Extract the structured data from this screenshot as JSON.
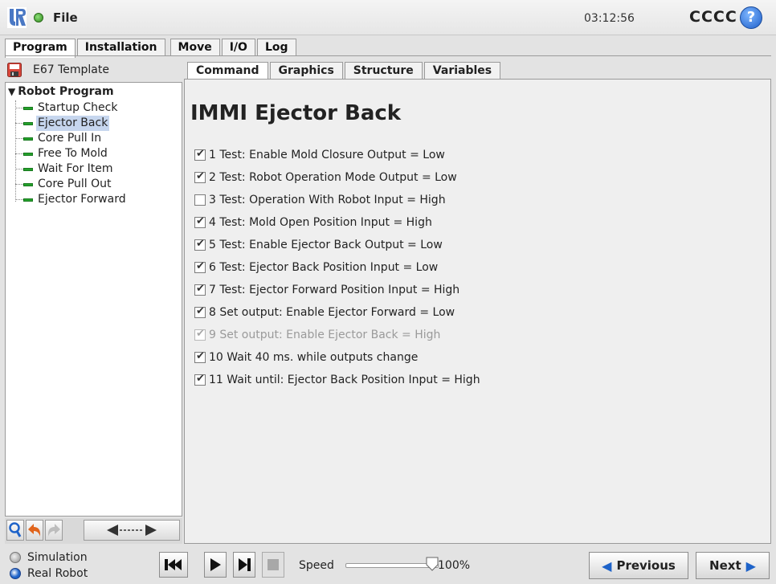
{
  "topbar": {
    "file_label": "File",
    "time": "03:12:56",
    "robot_name": "CCCC",
    "help_glyph": "?"
  },
  "main_tabs": [
    "Program",
    "Installation",
    "Move",
    "I/O",
    "Log"
  ],
  "left": {
    "program_name": "E67 Template",
    "tree_root": "Robot Program",
    "tree_items": [
      "Startup Check",
      "Ejector Back",
      "Core Pull In",
      "Free To Mold",
      "Wait For Item",
      "Core Pull Out",
      "Ejector Forward"
    ],
    "selected_item": "Ejector Back"
  },
  "sub_tabs": [
    "Command",
    "Graphics",
    "Structure",
    "Variables"
  ],
  "content": {
    "title": "IMMI Ejector Back",
    "checks": [
      {
        "label": "1 Test: Enable Mold Closure Output = Low",
        "checked": true,
        "enabled": true
      },
      {
        "label": "2 Test: Robot Operation Mode Output = Low",
        "checked": true,
        "enabled": true
      },
      {
        "label": "3 Test: Operation With Robot Input = High",
        "checked": false,
        "enabled": true
      },
      {
        "label": "4 Test: Mold Open Position Input = High",
        "checked": true,
        "enabled": true
      },
      {
        "label": "5 Test: Enable Ejector Back Output = Low",
        "checked": true,
        "enabled": true
      },
      {
        "label": "6 Test: Ejector Back Position Input = Low",
        "checked": true,
        "enabled": true
      },
      {
        "label": "7 Test: Ejector Forward Position Input = High",
        "checked": true,
        "enabled": true
      },
      {
        "label": "8 Set output: Enable Ejector Forward = Low",
        "checked": true,
        "enabled": true
      },
      {
        "label": "9 Set output: Enable Ejector Back = High",
        "checked": true,
        "enabled": false
      },
      {
        "label": "10 Wait 40 ms. while outputs change",
        "checked": true,
        "enabled": true
      },
      {
        "label": "11 Wait until: Ejector Back Position Input = High",
        "checked": true,
        "enabled": true
      }
    ]
  },
  "bottom": {
    "simulation_label": "Simulation",
    "real_robot_label": "Real Robot",
    "speed_label": "Speed",
    "speed_value": "100%",
    "speed_fraction": 1.0,
    "previous_label": "Previous",
    "next_label": "Next"
  },
  "colors": {
    "accent_blue": "#1e63c9",
    "node_green": "#24a12b",
    "selection": "#c6d6ee"
  }
}
